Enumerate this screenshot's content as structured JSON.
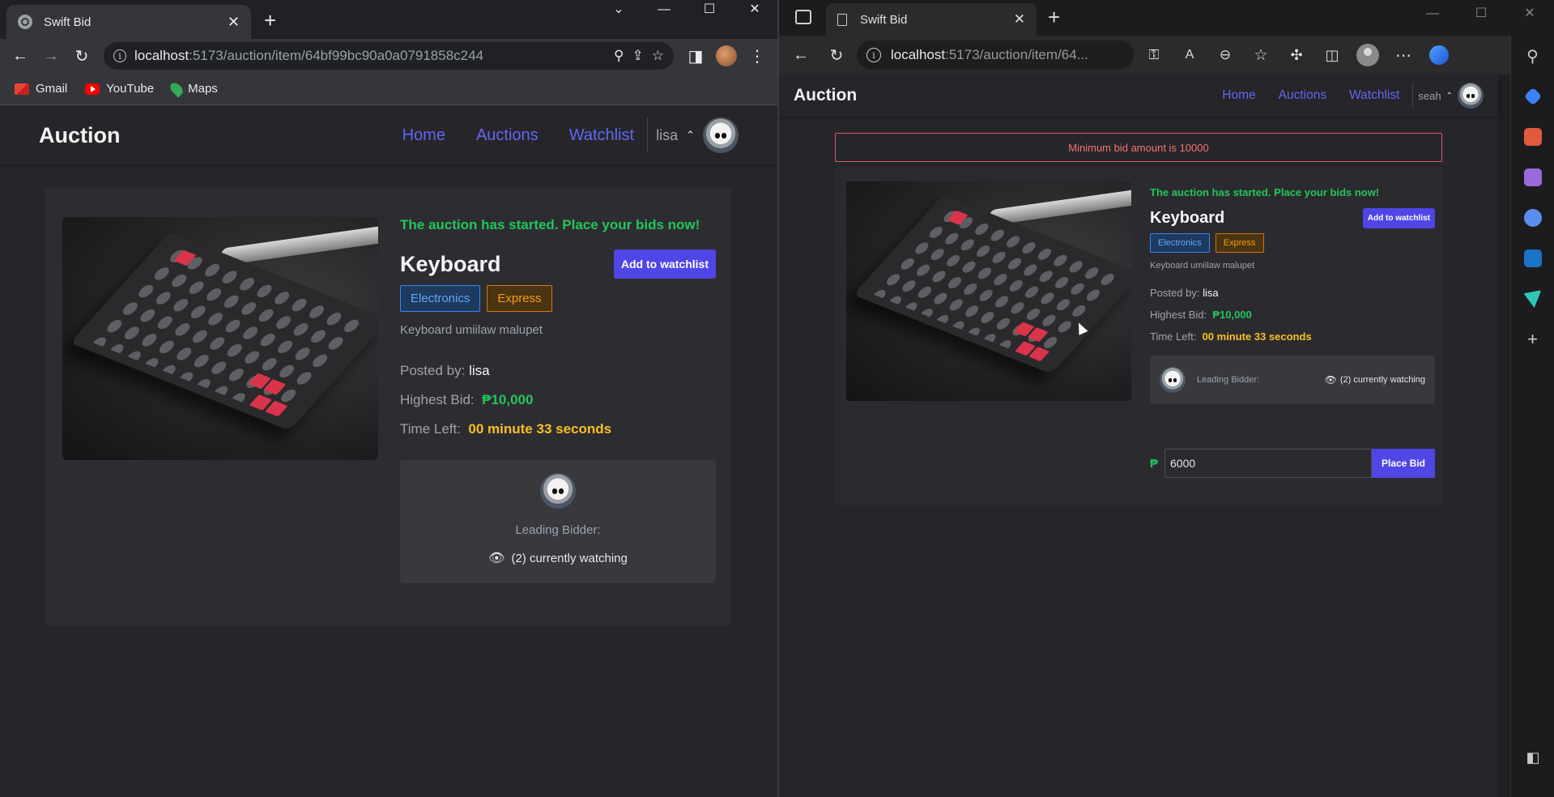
{
  "left_window": {
    "tab": {
      "title": "Swift Bid"
    },
    "omnibox": {
      "host": "localhost",
      "path": ":5173/auction/item/64bf99bc90a0a0791858c244"
    },
    "bookmarks": [
      {
        "label": "Gmail",
        "icon": "gmail-icon"
      },
      {
        "label": "YouTube",
        "icon": "youtube-icon"
      },
      {
        "label": "Maps",
        "icon": "maps-icon"
      }
    ],
    "page": {
      "brand": "Auction",
      "nav": {
        "home": "Home",
        "auctions": "Auctions",
        "watchlist": "Watchlist"
      },
      "user": {
        "name": "lisa",
        "chevron": "^"
      },
      "item": {
        "status": "The auction has started. Place your bids now!",
        "name": "Keyboard",
        "watch_btn": "Add to watchlist",
        "tags": [
          "Electronics",
          "Express"
        ],
        "description": "Keyboard umiilaw malupet",
        "posted_by_label": "Posted by:",
        "posted_by": "lisa",
        "highest_bid_label": "Highest Bid:",
        "highest_bid": "₱10,000",
        "time_left_label": "Time Left:",
        "time_left": "00 minute 33 seconds",
        "leading_bidder_label": "Leading Bidder:",
        "watching": "(2) currently watching"
      }
    }
  },
  "right_window": {
    "tab": {
      "title": "Swift Bid"
    },
    "omnibox": {
      "host": "localhost",
      "path": ":5173/auction/item/64..."
    },
    "page": {
      "brand": "Auction",
      "nav": {
        "home": "Home",
        "auctions": "Auctions",
        "watchlist": "Watchlist"
      },
      "user": {
        "name": "seah",
        "chevron": "^"
      },
      "alert": "Minimum bid amount is 10000",
      "item": {
        "status": "The auction has started. Place your bids now!",
        "name": "Keyboard",
        "watch_btn": "Add to watchlist",
        "tags": [
          "Electronics",
          "Express"
        ],
        "description": "Keyboard umiilaw malupet",
        "posted_by_label": "Posted by:",
        "posted_by": "lisa",
        "highest_bid_label": "Highest Bid:",
        "highest_bid": "₱10,000",
        "time_left_label": "Time Left:",
        "time_left": "00 minute 33 seconds",
        "leading_bidder_label": "Leading Bidder:",
        "watching": "(2) currently watching"
      },
      "bid": {
        "currency": "₱",
        "value": "6000",
        "button": "Place Bid"
      }
    }
  },
  "colors": {
    "accent": "#4f46e5",
    "nav_link": "#6366f1",
    "success": "#22c55e",
    "warning": "#fbbf24",
    "error": "#f87171"
  }
}
